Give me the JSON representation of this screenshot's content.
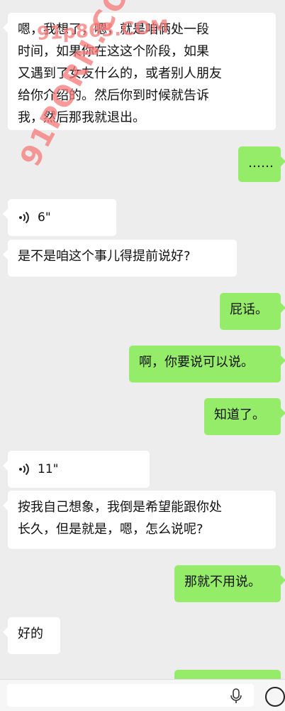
{
  "messages": [
    {
      "side": "in",
      "text": "嗯，我想了，嗯，就是咱俩处一段\n时间，如果你在这这个阶段，如果\n又遇到了女友什么的，或者别人朋友\n给你介绍的。然后你到时候就告诉\n我，然后那我就退出。"
    },
    {
      "side": "out",
      "text": "……"
    },
    {
      "side": "in",
      "type": "voice",
      "duration": "6\""
    },
    {
      "side": "in",
      "text": "是不是咱这个事儿得提前说好?"
    },
    {
      "side": "out",
      "text": "屁话。"
    },
    {
      "side": "out",
      "text": "啊，你要说可以说。"
    },
    {
      "side": "out",
      "text": "知道了。"
    },
    {
      "side": "in",
      "type": "voice",
      "duration": "11\""
    },
    {
      "side": "in",
      "text": "按我自己想象，我倒是希望能跟你处\n长久，但是就是，嗯，怎么说呢?"
    },
    {
      "side": "out",
      "text": "那就不用说。"
    },
    {
      "side": "in",
      "text": "好的"
    },
    {
      "side": "out",
      "text": ""
    }
  ],
  "watermark": {
    "top": "91p863.COM",
    "diagonal": "91PORN.COM"
  },
  "colors": {
    "background": "#ededed",
    "incoming_bubble": "#ffffff",
    "outgoing_bubble": "#95ec69"
  },
  "icons": {
    "voice": "voice-wave-icon",
    "mic": "mic-icon",
    "emoji": "emoji-icon"
  }
}
